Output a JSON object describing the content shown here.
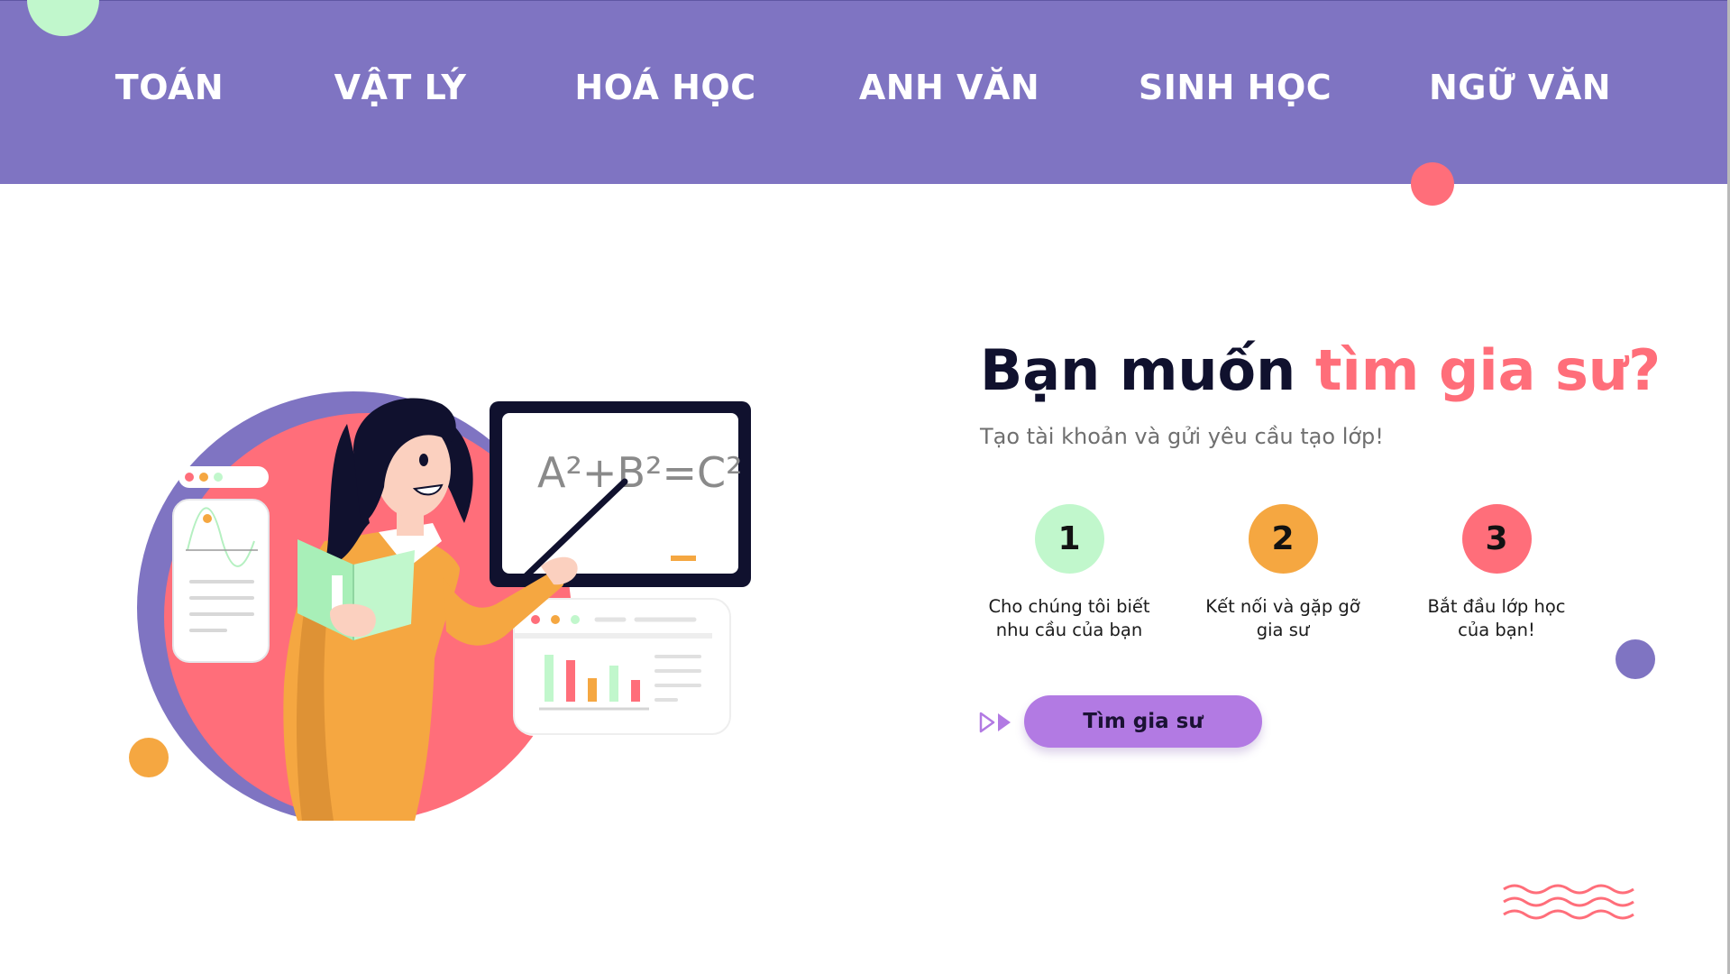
{
  "nav": {
    "items": [
      "TOÁN",
      "VẬT LÝ",
      "HOÁ HỌC",
      "ANH VĂN",
      "SINH HỌC",
      "NGỮ VĂN"
    ]
  },
  "hero": {
    "headline_main": "Bạn muốn ",
    "headline_accent": "tìm gia sư?",
    "subtitle": "Tạo tài khoản và gửi yêu cầu tạo lớp!",
    "steps": [
      {
        "number": "1",
        "line1": "Cho chúng tôi biết",
        "line2": "nhu cầu của bạn",
        "color": "#c1f7cc"
      },
      {
        "number": "2",
        "line1": "Kết nối và gặp gỡ",
        "line2": "gia sư",
        "color": "#f5a741"
      },
      {
        "number": "3",
        "line1": "Bắt đầu lớp học",
        "line2": "của bạn!",
        "color": "#ff6e7a"
      }
    ],
    "cta_label": "Tìm gia sư"
  },
  "illustration": {
    "board_formula": "A²+B²=C²"
  },
  "colors": {
    "nav_background": "#7f74c2",
    "accent_pink": "#ff6e7a",
    "accent_orange": "#f5a741",
    "accent_green": "#c1f7cc",
    "accent_purple": "#b27ae3"
  }
}
